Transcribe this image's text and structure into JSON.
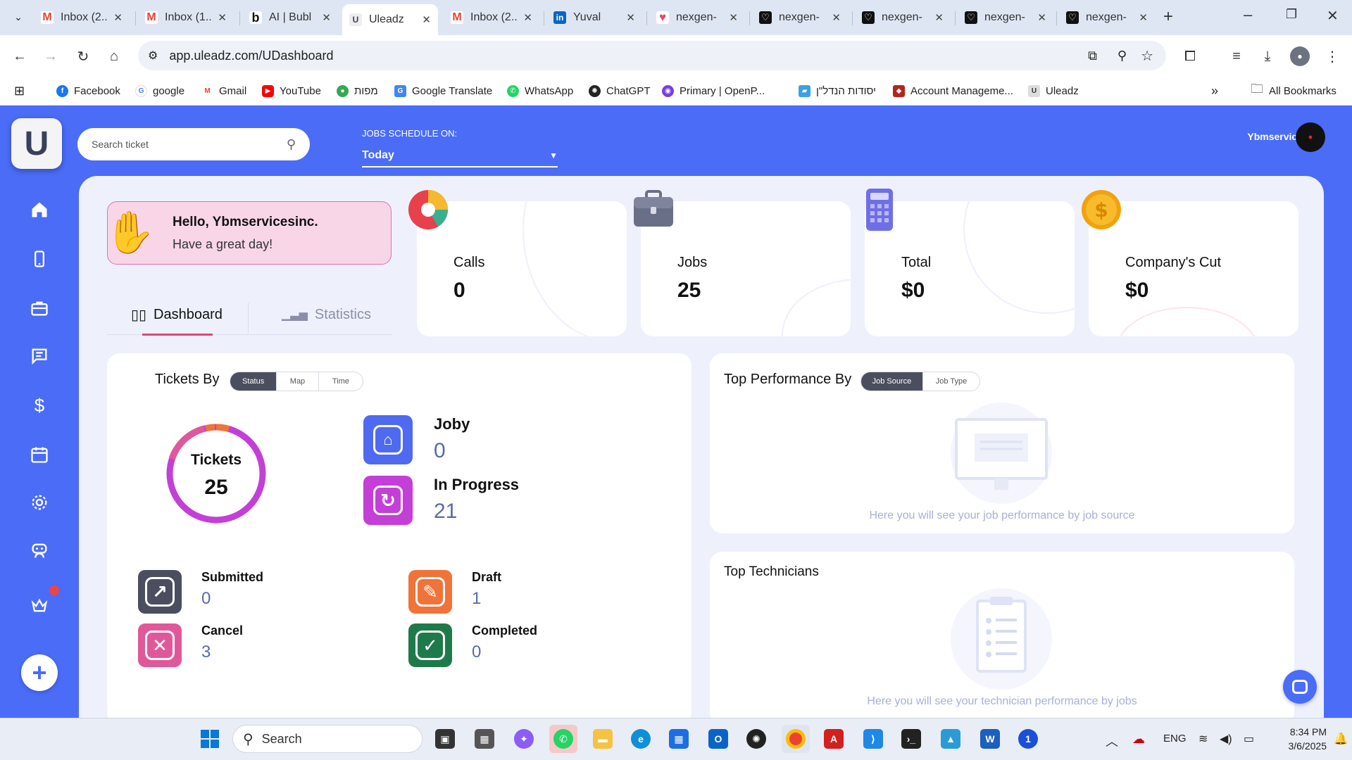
{
  "browser": {
    "tabs": [
      {
        "title": "Inbox (2..",
        "icon": "gmail-icon"
      },
      {
        "title": "Inbox (1..",
        "icon": "gmail-icon"
      },
      {
        "title": "AI | Bubl",
        "icon": "bubble-icon"
      },
      {
        "title": "Uleadz",
        "icon": "uleadz-icon"
      },
      {
        "title": "Inbox (2..",
        "icon": "gmail-icon"
      },
      {
        "title": "Yuval",
        "icon": "linkedin-icon"
      },
      {
        "title": "nexgen-",
        "icon": "heart-icon"
      },
      {
        "title": "nexgen-",
        "icon": "heart-outline-icon"
      },
      {
        "title": "nexgen-",
        "icon": "heart-outline-icon"
      },
      {
        "title": "nexgen-",
        "icon": "heart-outline-icon"
      },
      {
        "title": "nexgen-",
        "icon": "heart-outline-icon"
      }
    ],
    "url": "app.uleadz.com/UDashboard",
    "bookmarks": [
      {
        "label": "Facebook",
        "color": "#1877f2"
      },
      {
        "label": "google",
        "color": "#4285f4"
      },
      {
        "label": "Gmail",
        "color": "#ea4335"
      },
      {
        "label": "YouTube",
        "color": "#ff0000"
      },
      {
        "label": "מפות",
        "color": "#34a853"
      },
      {
        "label": "Google Translate",
        "color": "#4285f4"
      },
      {
        "label": "WhatsApp",
        "color": "#25d366"
      },
      {
        "label": "ChatGPT",
        "color": "#222222"
      },
      {
        "label": "Primary | OpenP...",
        "color": "#e0245e"
      },
      {
        "label": "יסודות הנדל\"ן",
        "color": "#3aa0e8"
      },
      {
        "label": "Account Manageme...",
        "color": "#b3261e"
      },
      {
        "label": "Uleadz",
        "color": "#888888"
      }
    ],
    "all_bookmarks": "All Bookmarks"
  },
  "app": {
    "search_placeholder": "Search ticket",
    "schedule_label": "JOBS SCHEDULE ON:",
    "schedule_value": "Today",
    "user_name": "Ybmservicesinc",
    "greeting_title": "Hello, Ybmservicesinc.",
    "greeting_sub": "Have a great day!",
    "tab_dashboard": "Dashboard",
    "tab_statistics": "Statistics",
    "stats": [
      {
        "label": "Calls",
        "value": "0"
      },
      {
        "label": "Jobs",
        "value": "25"
      },
      {
        "label": "Total",
        "value": "$0"
      },
      {
        "label": "Company's Cut",
        "value": "$0"
      }
    ],
    "tickets": {
      "title": "Tickets By",
      "filters": [
        "Status",
        "Map",
        "Time"
      ],
      "donut_label": "Tickets",
      "donut_value": "25",
      "joby": {
        "name": "Joby",
        "value": "0"
      },
      "in_progress": {
        "name": "In Progress",
        "value": "21"
      },
      "submitted": {
        "name": "Submitted",
        "value": "0"
      },
      "draft": {
        "name": "Draft",
        "value": "1"
      },
      "cancel": {
        "name": "Cancel",
        "value": "3"
      },
      "completed": {
        "name": "Completed",
        "value": "0"
      }
    },
    "top_performance": {
      "title": "Top Performance By",
      "filters": [
        "Job Source",
        "Job Type"
      ],
      "empty": "Here you will see your job performance by job source"
    },
    "top_technicians": {
      "title": "Top Technicians",
      "empty": "Here you will see your technician performance by jobs"
    }
  },
  "taskbar": {
    "search": "Search",
    "lang": "ENG",
    "time": "8:34 PM",
    "date": "3/6/2025"
  }
}
